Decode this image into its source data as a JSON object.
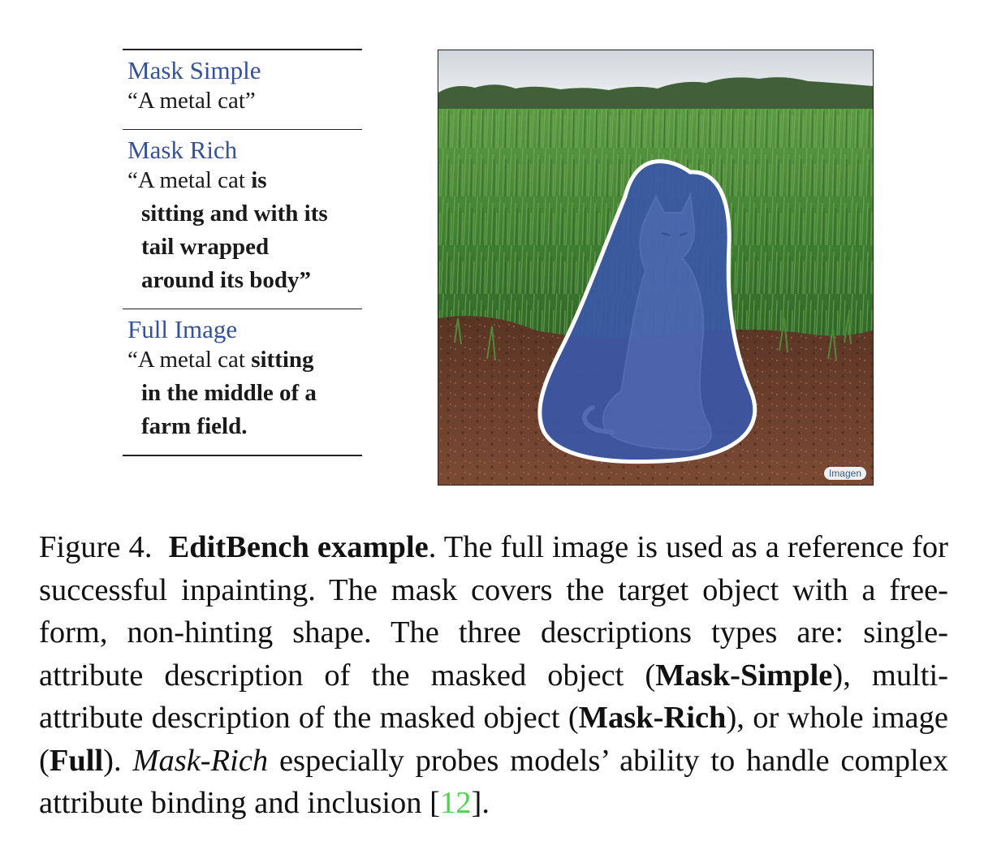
{
  "descriptions": [
    {
      "title": "Mask Simple",
      "quote_open": "“A metal cat”",
      "bold_lines": [],
      "plain_lines": []
    },
    {
      "title": "Mask Rich",
      "first_plain": "“A metal cat ",
      "first_bold": "is",
      "bold_lines": [
        "sitting and with its",
        "tail wrapped",
        "around its body”"
      ]
    },
    {
      "title": "Full Image",
      "first_plain": "“A metal cat ",
      "first_bold": "sitting",
      "bold_lines": [
        "in the middle of a",
        "farm field."
      ]
    }
  ],
  "image": {
    "watermark": "Imagen",
    "colors": {
      "sky": "#dfe3e6",
      "trees": "#3f5a32",
      "grass": "#4f8a3a",
      "soil": "#6a3e2c",
      "mask": "#3a57a6",
      "mask_outline": "#ffffff"
    }
  },
  "caption": {
    "figure_label": "Figure 4.",
    "title_bold": "EditBench example",
    "s1": ". The full image is used as a reference for successful inpainting. The mask covers the target object with a free-form, non-hinting shape. The three descriptions types are: single-attribute description of the masked object (",
    "b1": "Mask-Simple",
    "s2": "), multi-attribute description of the masked object (",
    "b2": "Mask-Rich",
    "s3": "), or whole image (",
    "b3": "Full",
    "s4": "). ",
    "i1": "Mask-Rich",
    "s5": " especially probes models’ ability to handle complex attribute binding and inclusion [",
    "cite": "12",
    "s6": "]."
  }
}
